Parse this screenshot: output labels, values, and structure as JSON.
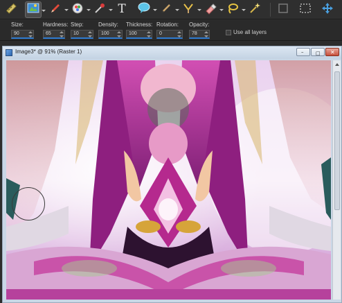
{
  "toolbar": {
    "tools": [
      {
        "name": "straighten-icon",
        "active": false,
        "dropdown": false
      },
      {
        "name": "selection-icon",
        "active": true,
        "dropdown": true
      },
      {
        "name": "pen-icon",
        "active": false,
        "dropdown": true
      },
      {
        "name": "color-replacer-icon",
        "active": false,
        "dropdown": true
      },
      {
        "name": "color-picker-icon",
        "active": false,
        "dropdown": true
      },
      {
        "name": "text-tool-icon",
        "active": false,
        "dropdown": false
      },
      {
        "name": "speech-bubble-shape-icon",
        "active": false,
        "dropdown": true
      },
      {
        "name": "paint-brush-icon",
        "active": false,
        "dropdown": true
      },
      {
        "name": "warp-brush-icon",
        "active": false,
        "dropdown": true
      },
      {
        "name": "eraser-icon",
        "active": false,
        "dropdown": true
      },
      {
        "name": "lasso-icon",
        "active": false,
        "dropdown": true
      },
      {
        "name": "magic-fill-icon",
        "active": false,
        "dropdown": true
      },
      {
        "name": "crop-icon",
        "active": false,
        "dropdown": false
      },
      {
        "name": "marquee-icon",
        "active": false,
        "dropdown": false
      },
      {
        "name": "move-icon",
        "active": false,
        "dropdown": false
      }
    ]
  },
  "options": {
    "size": {
      "label": "Size:",
      "value": "90"
    },
    "hardness": {
      "label": "Hardness:",
      "value": "65"
    },
    "step": {
      "label": "Step:",
      "value": "10"
    },
    "density": {
      "label": "Density:",
      "value": "100"
    },
    "thickness": {
      "label": "Thickness:",
      "value": "100"
    },
    "rotation": {
      "label": "Rotation:",
      "value": "0"
    },
    "opacity": {
      "label": "Opacity:",
      "value": "78"
    },
    "use_all_layers": {
      "label": "Use all layers",
      "checked": false
    }
  },
  "document": {
    "title": "Image3* @  91% (Raster 1)",
    "minimize": "–",
    "maximize": "□",
    "close": "✕"
  },
  "colors": {
    "accent": "#2f7cd1",
    "canvas_magenta": "#a02a8f",
    "canvas_pink": "#e6a4da",
    "canvas_teal": "#2a5c5c"
  }
}
